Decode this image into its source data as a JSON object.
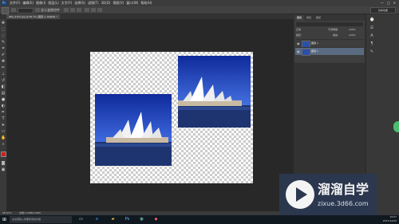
{
  "menubar": {
    "app_logo": "Ps",
    "items": [
      "文件(F)",
      "编辑(E)",
      "图像(I)",
      "图层(L)",
      "文字(Y)",
      "选择(S)",
      "滤镜(T)",
      "3D(D)",
      "视图(V)",
      "窗口(W)",
      "帮助(H)"
    ],
    "window_controls": {
      "minimize": "—",
      "maximize": "□",
      "close": "✕"
    }
  },
  "optionsbar": {
    "label_show_transform": "显示变换控件",
    "workspace": "基本功能"
  },
  "document": {
    "tab_title": "IMG_0123.jpg @ 66.7% (图层 1, RGB/8) *"
  },
  "statusbar": {
    "zoom": "66.67%",
    "doc_info": "文档:1.20M/2.40M"
  },
  "layers": {
    "tabs": [
      "图层",
      "通道",
      "路径"
    ],
    "blend_mode": "正常",
    "opacity_label": "不透明度:",
    "opacity_value": "100%",
    "lock_label": "锁定:",
    "fill_label": "填充:",
    "fill_value": "100%",
    "rows": [
      {
        "name": "图层 1",
        "selected": false
      },
      {
        "name": "图层 1",
        "selected": true
      }
    ]
  },
  "watermark": {
    "brand": "溜溜自学",
    "url": "zixue.3d66.com"
  },
  "taskbar": {
    "search_placeholder": "在这里输入你要搜索的内容",
    "time": "19:07",
    "date": "2017/12/20"
  },
  "icons": {
    "start": "windows-start-icon",
    "eye": "eye-icon"
  },
  "colors": {
    "foreground_swatch": "#cc1f1f",
    "background_swatch": "#ffffff",
    "accent_selected_layer": "#5a6a80",
    "watermark_bg": "#2b3850"
  }
}
